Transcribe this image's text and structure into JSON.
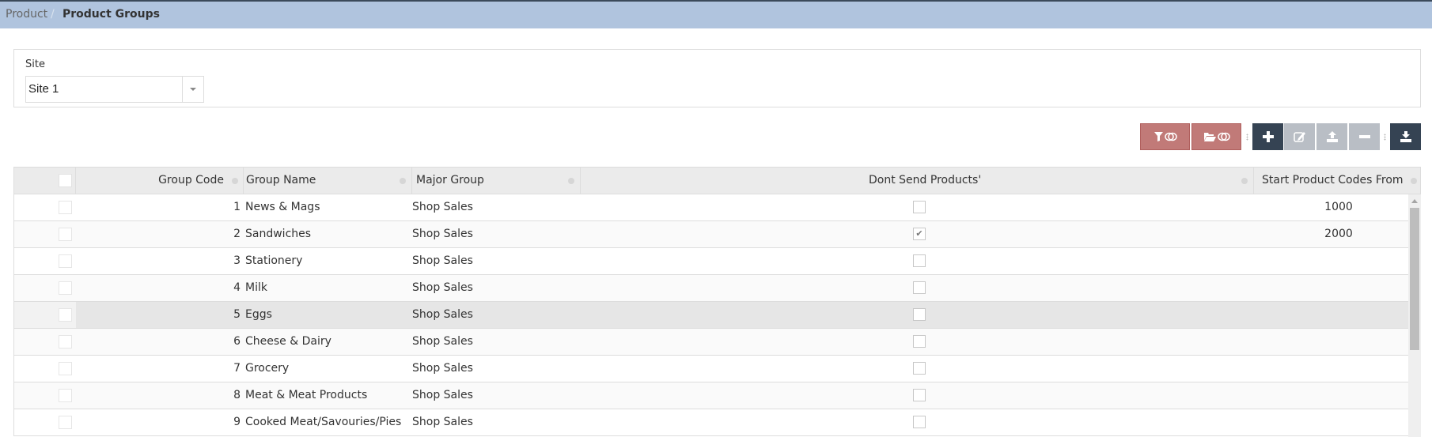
{
  "breadcrumb": {
    "parent": "Product",
    "separator": "/",
    "current": "Product Groups"
  },
  "site_filter": {
    "label": "Site",
    "selected": "Site 1"
  },
  "toolbar": {
    "buttons": [
      {
        "name": "filter-toggle",
        "icons": [
          "filter-icon",
          "toggle-icon"
        ],
        "color": "#c17a78"
      },
      {
        "name": "folder-toggle",
        "icons": [
          "folder-open-icon",
          "toggle-icon"
        ],
        "color": "#c17a78"
      },
      {
        "name": "add",
        "icon": "plus-icon",
        "enabled": true,
        "color": "#354353"
      },
      {
        "name": "edit",
        "icon": "edit-icon",
        "enabled": false,
        "color": "#b9bec5"
      },
      {
        "name": "upload",
        "icon": "upload-icon",
        "enabled": false,
        "color": "#b9bec5"
      },
      {
        "name": "remove",
        "icon": "minus-icon",
        "enabled": false,
        "color": "#b9bec5"
      },
      {
        "name": "download",
        "icon": "download-icon",
        "enabled": true,
        "color": "#354353"
      }
    ]
  },
  "grid": {
    "columns": [
      "Group Code",
      "Group Name",
      "Major Group",
      "Dont Send Products'",
      "Start Product Codes From"
    ],
    "rows": [
      {
        "code": "1",
        "name": "News & Mags",
        "major": "Shop Sales",
        "dont_send": false,
        "start": "1000"
      },
      {
        "code": "2",
        "name": "Sandwiches",
        "major": "Shop Sales",
        "dont_send": true,
        "start": "2000"
      },
      {
        "code": "3",
        "name": "Stationery",
        "major": "Shop Sales",
        "dont_send": false,
        "start": ""
      },
      {
        "code": "4",
        "name": "Milk",
        "major": "Shop Sales",
        "dont_send": false,
        "start": ""
      },
      {
        "code": "5",
        "name": "Eggs",
        "major": "Shop Sales",
        "dont_send": false,
        "start": "",
        "hover": true
      },
      {
        "code": "6",
        "name": "Cheese & Dairy",
        "major": "Shop Sales",
        "dont_send": false,
        "start": ""
      },
      {
        "code": "7",
        "name": "Grocery",
        "major": "Shop Sales",
        "dont_send": false,
        "start": ""
      },
      {
        "code": "8",
        "name": "Meat & Meat Products",
        "major": "Shop Sales",
        "dont_send": false,
        "start": ""
      },
      {
        "code": "9",
        "name": "Cooked Meat/Savouries/Pies",
        "major": "Shop Sales",
        "dont_send": false,
        "start": ""
      }
    ]
  }
}
